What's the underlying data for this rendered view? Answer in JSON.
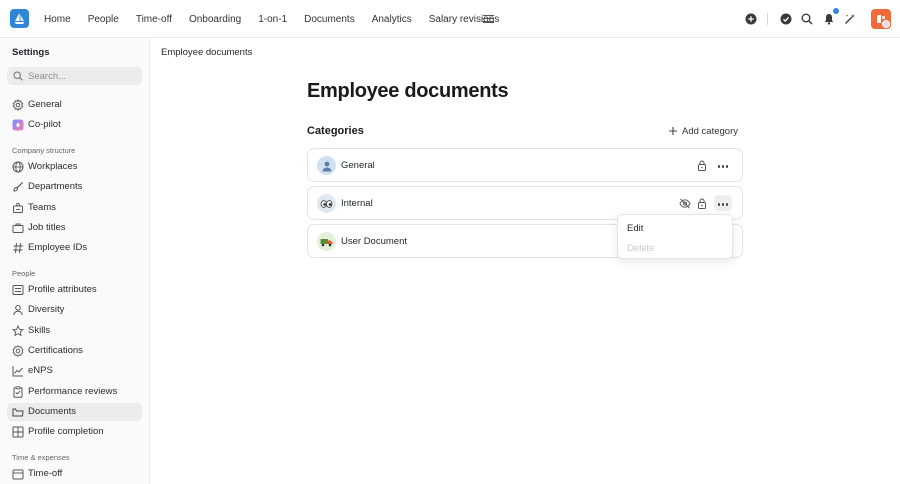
{
  "topnav": {
    "items": [
      "Home",
      "People",
      "Time-off",
      "Onboarding",
      "1-on-1",
      "Documents",
      "Analytics",
      "Salary revisions"
    ],
    "icons": [
      "add-circle-icon",
      "check-circle-icon",
      "search-icon",
      "bell-icon",
      "magic-wand-icon"
    ],
    "accent": "#2f86d6",
    "avatar_color": "#f06a3a"
  },
  "sidebar": {
    "title": "Settings",
    "search_placeholder": "Search...",
    "top_items": [
      {
        "label": "General",
        "icon": "gear-icon"
      },
      {
        "label": "Co-pilot",
        "icon": "copilot-icon"
      }
    ],
    "sections": [
      {
        "title": "Company structure",
        "items": [
          {
            "label": "Workplaces",
            "icon": "globe-icon"
          },
          {
            "label": "Departments",
            "icon": "brush-icon"
          },
          {
            "label": "Teams",
            "icon": "team-icon"
          },
          {
            "label": "Job titles",
            "icon": "briefcase-icon"
          },
          {
            "label": "Employee IDs",
            "icon": "hash-icon"
          }
        ]
      },
      {
        "title": "People",
        "items": [
          {
            "label": "Profile attributes",
            "icon": "list-icon"
          },
          {
            "label": "Diversity",
            "icon": "person-icon"
          },
          {
            "label": "Skills",
            "icon": "star-icon"
          },
          {
            "label": "Certifications",
            "icon": "badge-icon"
          },
          {
            "label": "eNPS",
            "icon": "trend-icon"
          },
          {
            "label": "Performance reviews",
            "icon": "clipboard-icon"
          },
          {
            "label": "Documents",
            "icon": "folder-icon",
            "active": true
          },
          {
            "label": "Profile completion",
            "icon": "grid-icon"
          }
        ]
      },
      {
        "title": "Time & expenses",
        "items": [
          {
            "label": "Time-off",
            "icon": "calendar-icon"
          }
        ]
      }
    ]
  },
  "main": {
    "breadcrumb": "Employee documents",
    "title": "Employee documents",
    "categories_label": "Categories",
    "add_category": "Add category",
    "categories": [
      {
        "name": "General",
        "icon": "person-silhouette-icon",
        "locked": true,
        "hidden": false
      },
      {
        "name": "Internal",
        "icon": "eyes-icon",
        "locked": true,
        "hidden": true
      },
      {
        "name": "User Document",
        "icon": "truck-icon",
        "locked": false,
        "hidden": false
      }
    ],
    "menu": {
      "edit": "Edit",
      "delete": "Delete"
    }
  }
}
